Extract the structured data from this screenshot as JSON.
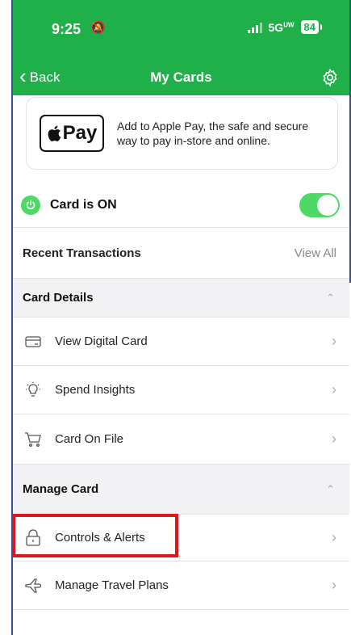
{
  "status_bar": {
    "time": "9:25",
    "network": "5G",
    "network_sup": "UW",
    "battery": "84"
  },
  "nav": {
    "back_label": "Back",
    "title": "My Cards"
  },
  "apple_pay": {
    "badge_text": "Pay",
    "message": "Add to Apple Pay, the safe and secure way to pay in-store and online."
  },
  "card_status": {
    "label": "Card is ON",
    "enabled": true
  },
  "recent_transactions": {
    "label": "Recent Transactions",
    "action": "View All"
  },
  "card_details": {
    "title": "Card Details",
    "items": [
      {
        "label": "View Digital Card",
        "icon": "card-icon"
      },
      {
        "label": "Spend Insights",
        "icon": "lightbulb-icon"
      },
      {
        "label": "Card On File",
        "icon": "cart-icon"
      }
    ]
  },
  "manage_card": {
    "title": "Manage Card",
    "items": [
      {
        "label": "Controls & Alerts",
        "icon": "lock-icon"
      },
      {
        "label": "Manage Travel Plans",
        "icon": "airplane-icon"
      }
    ]
  },
  "colors": {
    "brand_green": "#1fb04a",
    "toggle_green": "#4cd964",
    "highlight_red": "#e0161b"
  }
}
